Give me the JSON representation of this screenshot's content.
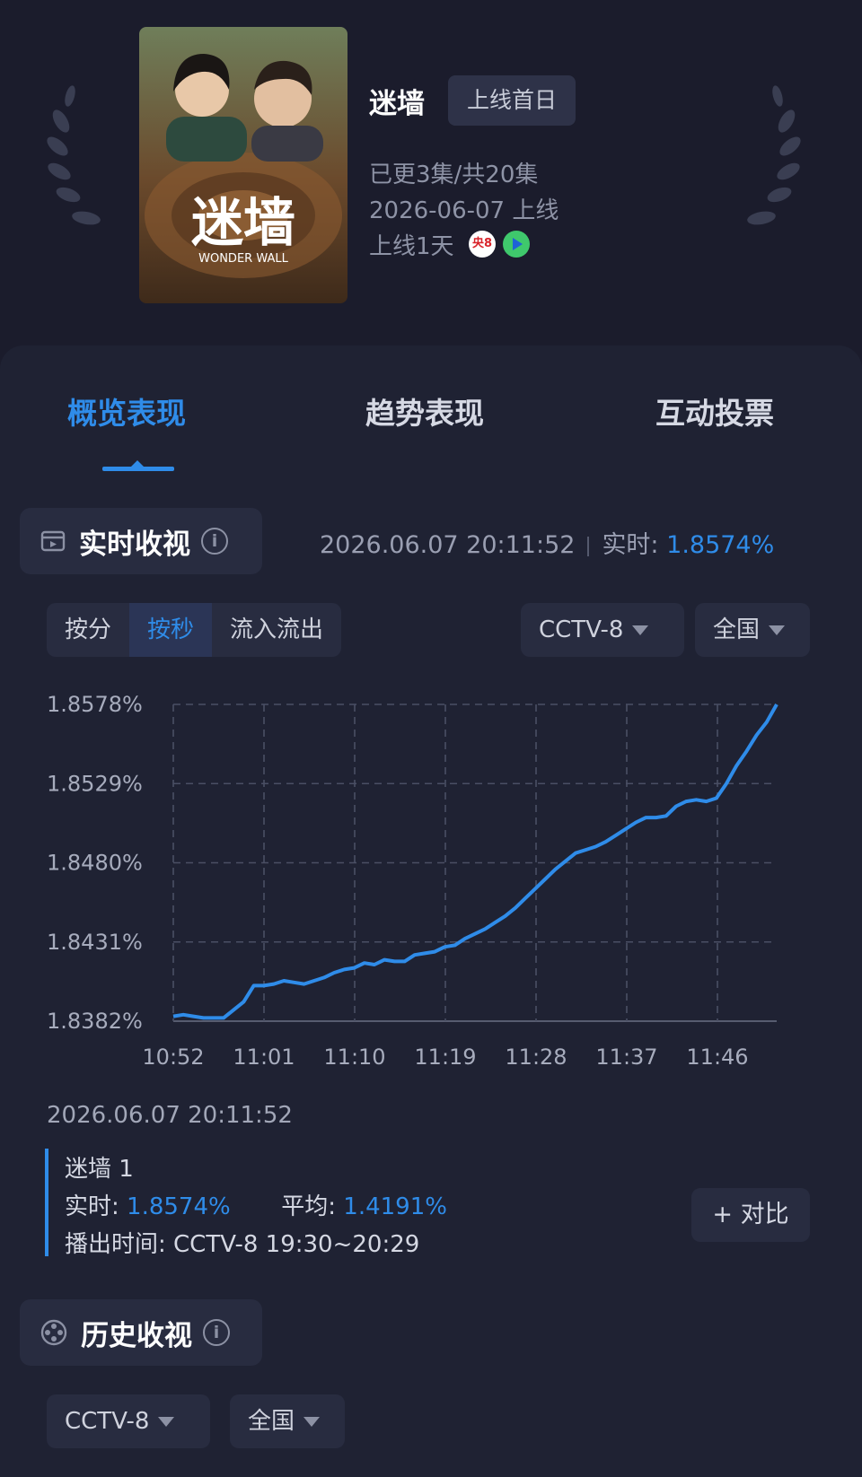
{
  "header": {
    "title": "迷墙",
    "badge": "上线首日",
    "episodes": "已更3集/共20集",
    "release": "2026-06-07 上线",
    "days_online": "上线1天",
    "platform_badge": "央8",
    "poster": {
      "title_art": "迷墙",
      "subtitle_art": "WONDER WALL"
    }
  },
  "tabs": [
    {
      "label": "概览表现",
      "active": true
    },
    {
      "label": "趋势表现",
      "active": false
    },
    {
      "label": "互动投票",
      "active": false
    }
  ],
  "realtime": {
    "section_title": "实时收视",
    "timestamp": "2026.06.07 20:11:52",
    "rate_label": "实时:",
    "rate_value": "1.8574%",
    "segments": [
      {
        "label": "按分",
        "active": false
      },
      {
        "label": "按秒",
        "active": true
      },
      {
        "label": "流入流出",
        "active": false
      }
    ],
    "channel_select": "CCTV-8",
    "region_select": "全国"
  },
  "chart_data": {
    "type": "line",
    "x_ticks": [
      "10:52",
      "11:01",
      "11:10",
      "11:19",
      "11:28",
      "11:37",
      "11:46"
    ],
    "y_ticks": [
      "1.8578%",
      "1.8529%",
      "1.8480%",
      "1.8431%",
      "1.8382%"
    ],
    "ylim": [
      1.8382,
      1.8578
    ],
    "grid": true,
    "series": [
      {
        "x_minutes_from_1052": [
          0,
          1,
          2,
          3,
          4,
          5,
          6,
          7,
          8,
          9,
          10,
          11,
          12,
          13,
          14,
          15,
          16,
          17,
          18,
          19,
          20,
          21,
          22,
          23,
          24,
          25,
          26,
          27,
          28,
          29,
          30,
          31,
          32,
          33,
          34,
          35,
          36,
          37,
          38,
          39,
          40,
          41,
          42,
          43,
          44,
          45,
          46,
          47,
          48,
          49,
          50,
          51,
          52,
          53,
          54,
          55,
          56,
          57,
          58,
          59,
          60
        ],
        "values": [
          1.8385,
          1.8386,
          1.8385,
          1.8384,
          1.8384,
          1.8384,
          1.8389,
          1.8394,
          1.8404,
          1.8404,
          1.8405,
          1.8407,
          1.8406,
          1.8405,
          1.8407,
          1.8409,
          1.8412,
          1.8414,
          1.8415,
          1.8418,
          1.8417,
          1.842,
          1.8419,
          1.8419,
          1.8423,
          1.8424,
          1.8425,
          1.8428,
          1.8429,
          1.8433,
          1.8436,
          1.8439,
          1.8443,
          1.8447,
          1.8452,
          1.8458,
          1.8464,
          1.847,
          1.8476,
          1.8481,
          1.8486,
          1.8488,
          1.849,
          1.8493,
          1.8497,
          1.8501,
          1.8505,
          1.8508,
          1.8508,
          1.8509,
          1.8515,
          1.8518,
          1.8519,
          1.8518,
          1.852,
          1.8529,
          1.854,
          1.8549,
          1.8559,
          1.8567,
          1.8578
        ]
      }
    ]
  },
  "detail": {
    "timestamp": "2026.06.07 20:11:52",
    "episode": "迷墙 1",
    "realtime_label": "实时:",
    "realtime_value": "1.8574%",
    "average_label": "平均:",
    "average_value": "1.4191%",
    "broadcast_label": "播出时间:",
    "broadcast_value": "CCTV-8 19:30~20:29",
    "compare_label": "+ 对比"
  },
  "history": {
    "section_title": "历史收视",
    "channel_select": "CCTV-8",
    "region_select": "全国"
  },
  "colors": {
    "accent": "#2f8ce9",
    "background": "#1b1c2c",
    "panel": "#1f2233",
    "chip": "#282c40"
  },
  "icons": [
    "laurel-left-icon",
    "laurel-right-icon",
    "tv-icon",
    "info-icon",
    "film-reel-icon",
    "caret-down-icon",
    "cctv8-logo-icon",
    "play-logo-icon"
  ]
}
